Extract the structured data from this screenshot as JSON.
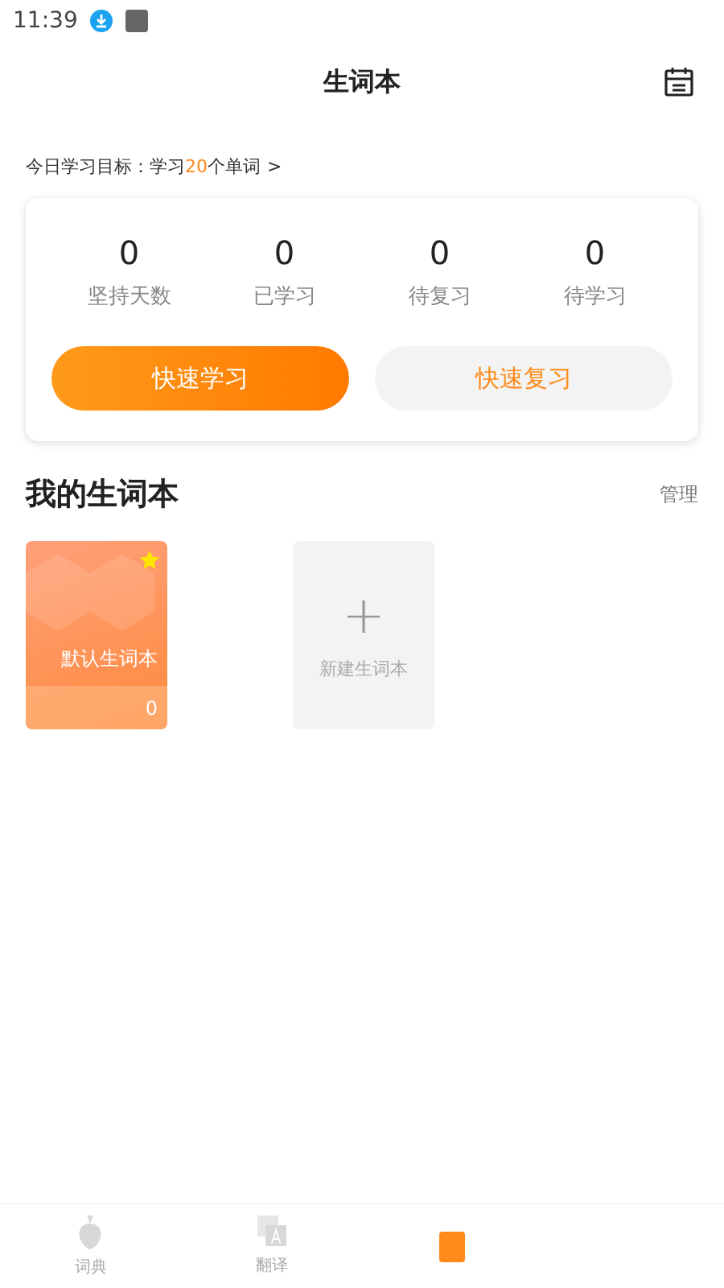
{
  "status_bar": {
    "time": "11:39"
  },
  "header": {
    "title": "生词本"
  },
  "goal": {
    "text": "今日学习目标：学习",
    "count": "20",
    "unit": "个单词",
    "chevron": ">"
  },
  "stats": [
    {
      "value": "0",
      "label": "坚持天数"
    },
    {
      "value": "0",
      "label": "已学习"
    },
    {
      "value": "0",
      "label": "待复习"
    },
    {
      "value": "0",
      "label": "待学习"
    }
  ],
  "actions": [
    {
      "label": "快速学习",
      "kind": "primary"
    },
    {
      "label": "快速复习",
      "kind": "secondary"
    }
  ],
  "section": {
    "title": "我的生词本",
    "manage": "管理"
  },
  "books": [
    {
      "kind": "book",
      "name": "默认生词本",
      "count": "0",
      "starred": true
    },
    {
      "kind": "new",
      "name": "新建生词本",
      "plus": "+"
    }
  ],
  "tabs": [
    {
      "label": "词典",
      "kind": "fruit",
      "selected": false
    },
    {
      "label": "翻译",
      "kind": "translate",
      "selected": false
    },
    {
      "kind": "book",
      "selected": true
    }
  ]
}
